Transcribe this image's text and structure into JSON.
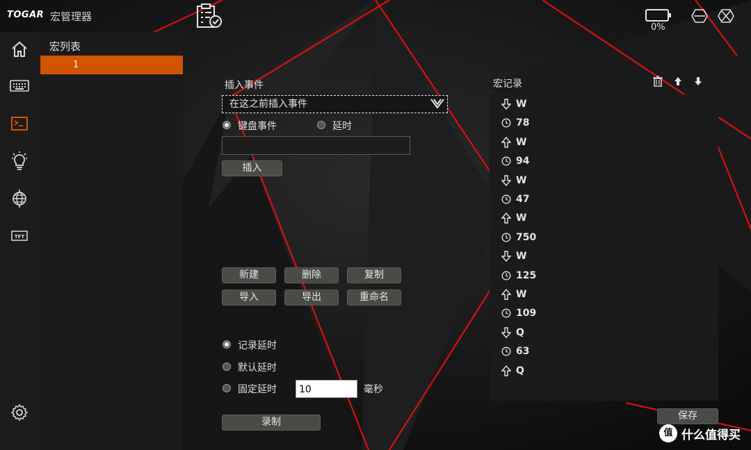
{
  "app": {
    "brand": "TOGAR",
    "title": "宏管理器"
  },
  "battery": {
    "percent_text": "0%",
    "level": 0
  },
  "nav": {
    "items": [
      {
        "name": "home-icon"
      },
      {
        "name": "keyboard-icon"
      },
      {
        "name": "macro-icon",
        "active": true
      },
      {
        "name": "lighting-icon"
      },
      {
        "name": "network-icon"
      },
      {
        "name": "tft-icon",
        "text": "TFT"
      },
      {
        "name": "settings-icon"
      }
    ]
  },
  "macro_list": {
    "title": "宏列表",
    "items": [
      "1"
    ]
  },
  "insert": {
    "title": "插入事件",
    "select_value": "在这之前插入事件",
    "radio_keyboard": "键盘事件",
    "radio_delay": "延时",
    "selected": "keyboard",
    "input_value": "",
    "insert_button": "插入"
  },
  "actions": {
    "new": "新建",
    "delete": "删除",
    "copy": "复制",
    "import": "导入",
    "export": "导出",
    "rename": "重命名"
  },
  "delay_mode": {
    "record": "记录延时",
    "default": "默认延时",
    "fixed": "固定延时",
    "selected": "record",
    "fixed_value": "10",
    "unit": "毫秒",
    "record_button": "录制"
  },
  "record": {
    "title": "宏记录",
    "save_button": "保存",
    "events": [
      {
        "type": "down",
        "value": "W"
      },
      {
        "type": "delay",
        "value": "78"
      },
      {
        "type": "up",
        "value": "W"
      },
      {
        "type": "delay",
        "value": "94"
      },
      {
        "type": "down",
        "value": "W"
      },
      {
        "type": "delay",
        "value": "47"
      },
      {
        "type": "up",
        "value": "W"
      },
      {
        "type": "delay",
        "value": "750"
      },
      {
        "type": "down",
        "value": "W"
      },
      {
        "type": "delay",
        "value": "125"
      },
      {
        "type": "up",
        "value": "W"
      },
      {
        "type": "delay",
        "value": "109"
      },
      {
        "type": "down",
        "value": "Q"
      },
      {
        "type": "delay",
        "value": "63"
      },
      {
        "type": "up",
        "value": "Q"
      }
    ]
  },
  "watermark": {
    "text": "什么值得买"
  },
  "colors": {
    "accent": "#d35400",
    "background": "#121212",
    "red_line": "#e01010"
  }
}
